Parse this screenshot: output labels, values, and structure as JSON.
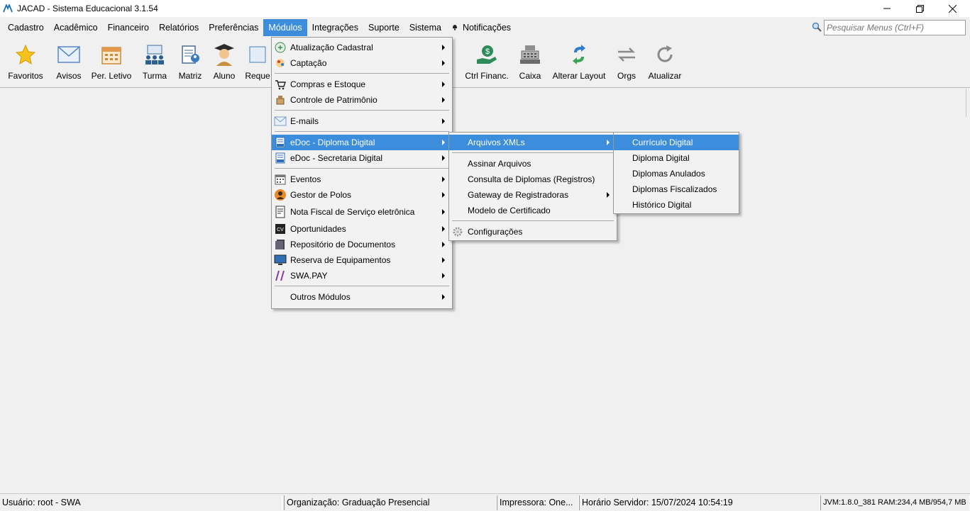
{
  "window": {
    "title": "JACAD - Sistema Educacional 3.1.54",
    "minimize": "—",
    "maximize": "❐",
    "close": "✕"
  },
  "menubar": {
    "items": [
      "Cadastro",
      "Acadêmico",
      "Financeiro",
      "Relatórios",
      "Preferências",
      "Módulos",
      "Integrações",
      "Suporte",
      "Sistema"
    ],
    "active": "Módulos",
    "notifications": "Notificações"
  },
  "search": {
    "placeholder": "Pesquisar Menus (Ctrl+F)"
  },
  "toolbar": {
    "items": [
      {
        "label": "Favoritos",
        "icon": "star-icon"
      },
      {
        "label": "Avisos",
        "icon": "envelope-icon"
      },
      {
        "label": "Per. Letivo",
        "icon": "calendar-icon"
      },
      {
        "label": "Turma",
        "icon": "class-group-icon"
      },
      {
        "label": "Matriz",
        "icon": "matrix-doc-icon"
      },
      {
        "label": "Aluno",
        "icon": "graduate-icon"
      },
      {
        "label": "Reque",
        "icon": "request-icon"
      },
      {
        "label": "Ctrl Financ.",
        "icon": "money-hand-icon"
      },
      {
        "label": "Caixa",
        "icon": "cash-register-icon"
      },
      {
        "label": "Alterar Layout",
        "icon": "layout-swap-icon"
      },
      {
        "label": "Orgs",
        "icon": "swap-arrows-icon"
      },
      {
        "label": "Atualizar",
        "icon": "refresh-icon"
      }
    ]
  },
  "modulos_menu": {
    "items": [
      {
        "label": "Atualização Cadastral",
        "icon": "update-register-icon",
        "submenu": true
      },
      {
        "label": "Captação",
        "icon": "capture-icon",
        "submenu": true
      },
      {
        "label": "Compras e Estoque",
        "icon": "shopping-icon",
        "submenu": true
      },
      {
        "label": "Controle de Patrimônio",
        "icon": "assets-icon",
        "submenu": true
      },
      {
        "label": "E-mails",
        "icon": "email-icon",
        "submenu": true
      },
      {
        "label": "eDoc - Diploma Digital",
        "icon": "edoc-diploma-icon",
        "submenu": true,
        "highlighted": true
      },
      {
        "label": "eDoc - Secretaria Digital",
        "icon": "edoc-secretaria-icon",
        "submenu": true
      },
      {
        "label": "Eventos",
        "icon": "events-calendar-icon",
        "submenu": true
      },
      {
        "label": "Gestor de Polos",
        "icon": "poles-manager-icon",
        "submenu": true
      },
      {
        "label": "Nota Fiscal de Serviço eletrônica",
        "icon": "invoice-icon",
        "submenu": true
      },
      {
        "label": "Oportunidades",
        "icon": "opportunities-icon",
        "submenu": true
      },
      {
        "label": "Repositório de Documentos",
        "icon": "documents-repo-icon",
        "submenu": true
      },
      {
        "label": "Reserva de Equipamentos",
        "icon": "monitor-icon",
        "submenu": true
      },
      {
        "label": "SWA.PAY",
        "icon": "swapay-icon",
        "submenu": true
      },
      {
        "label": "Outros Módulos",
        "icon": "",
        "submenu": true
      }
    ]
  },
  "edoc_menu": {
    "items": [
      {
        "label": "Arquivos XMLs",
        "submenu": true,
        "highlighted": true
      },
      {
        "label": "Assinar Arquivos",
        "submenu": false
      },
      {
        "label": "Consulta de Diplomas (Registros)",
        "submenu": false
      },
      {
        "label": "Gateway de Registradoras",
        "submenu": true
      },
      {
        "label": "Modelo de Certificado",
        "submenu": false
      },
      {
        "label": "Configurações",
        "icon": "gear-icon",
        "submenu": false
      }
    ]
  },
  "xml_menu": {
    "items": [
      {
        "label": "Currículo Digital",
        "highlighted": true
      },
      {
        "label": "Diploma Digital"
      },
      {
        "label": "Diplomas Anulados"
      },
      {
        "label": "Diplomas Fiscalizados"
      },
      {
        "label": "Histórico Digital"
      }
    ]
  },
  "statusbar": {
    "user": "Usuário: root - SWA",
    "org": "Organização: Graduação Presencial",
    "printer": "Impressora: One...",
    "server_time": "Horário Servidor: 15/07/2024 10:54:19",
    "jvm": "JVM:1.8.0_381  RAM:234,4 MB/954,7 MB"
  },
  "colors": {
    "highlight": "#3c8ddc",
    "background": "#f0f0f0"
  }
}
